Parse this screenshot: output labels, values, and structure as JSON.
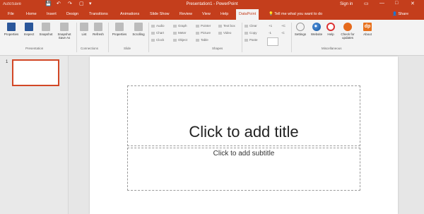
{
  "titlebar": {
    "autosave": "AutoSave",
    "title": "Presentation1 - PowerPoint",
    "signin": "Sign in",
    "qa": {
      "save": "💾",
      "undo": "↶",
      "redo": "↷",
      "start": "▢",
      "more": "▾"
    },
    "window": {
      "restore": "▭",
      "minimize": "—",
      "maximize": "□",
      "close": "✕"
    }
  },
  "tabs": {
    "file": "File",
    "home": "Home",
    "insert": "Insert",
    "design": "Design",
    "transitions": "Transitions",
    "animations": "Animations",
    "slideshow": "Slide Show",
    "review": "Review",
    "view": "View",
    "help": "Help",
    "datapoint": "DataPoint"
  },
  "tellme": "Tell me what you want to do",
  "share": "Share",
  "ribbon": {
    "presentation": {
      "group": "Presentation",
      "properties": "Properties",
      "inspect": "Inspect",
      "snapshot": "Snapshot",
      "snapshot_save_as": "Snapshot Save As"
    },
    "connections": {
      "group": "Connections",
      "list": "List",
      "refresh": "Refresh"
    },
    "slide": {
      "group": "Slide",
      "properties": "Properties",
      "scrolling": "Scrolling"
    },
    "shapes": {
      "group": "Shapes",
      "audio": "Audio",
      "graph": "Graph",
      "pointer": "Pointer",
      "textbox": "Text box",
      "chart": "Chart",
      "meter": "Meter",
      "picture": "Picture",
      "video": "Video",
      "clock": "Clock",
      "object": "Object",
      "table": "Table"
    },
    "edit": {
      "clear": "Clear",
      "copy": "Copy",
      "paste": "Paste",
      "plus1": "+1",
      "minus1": "-1",
      "plusc": "+C",
      "minusc": "-C"
    },
    "misc": {
      "group": "Miscellaneous",
      "settings": "Settings",
      "website": "Website",
      "help": "Help",
      "check_updates": "Check for updates",
      "about": "About",
      "dp_logo": "dp"
    }
  },
  "thumbs": {
    "slide_number": "1"
  },
  "slide": {
    "title_placeholder": "Click to add title",
    "subtitle_placeholder": "Click to add subtitle"
  },
  "colors": {
    "accent": "#c43e1c",
    "ribbon": "#f3f3f3"
  }
}
